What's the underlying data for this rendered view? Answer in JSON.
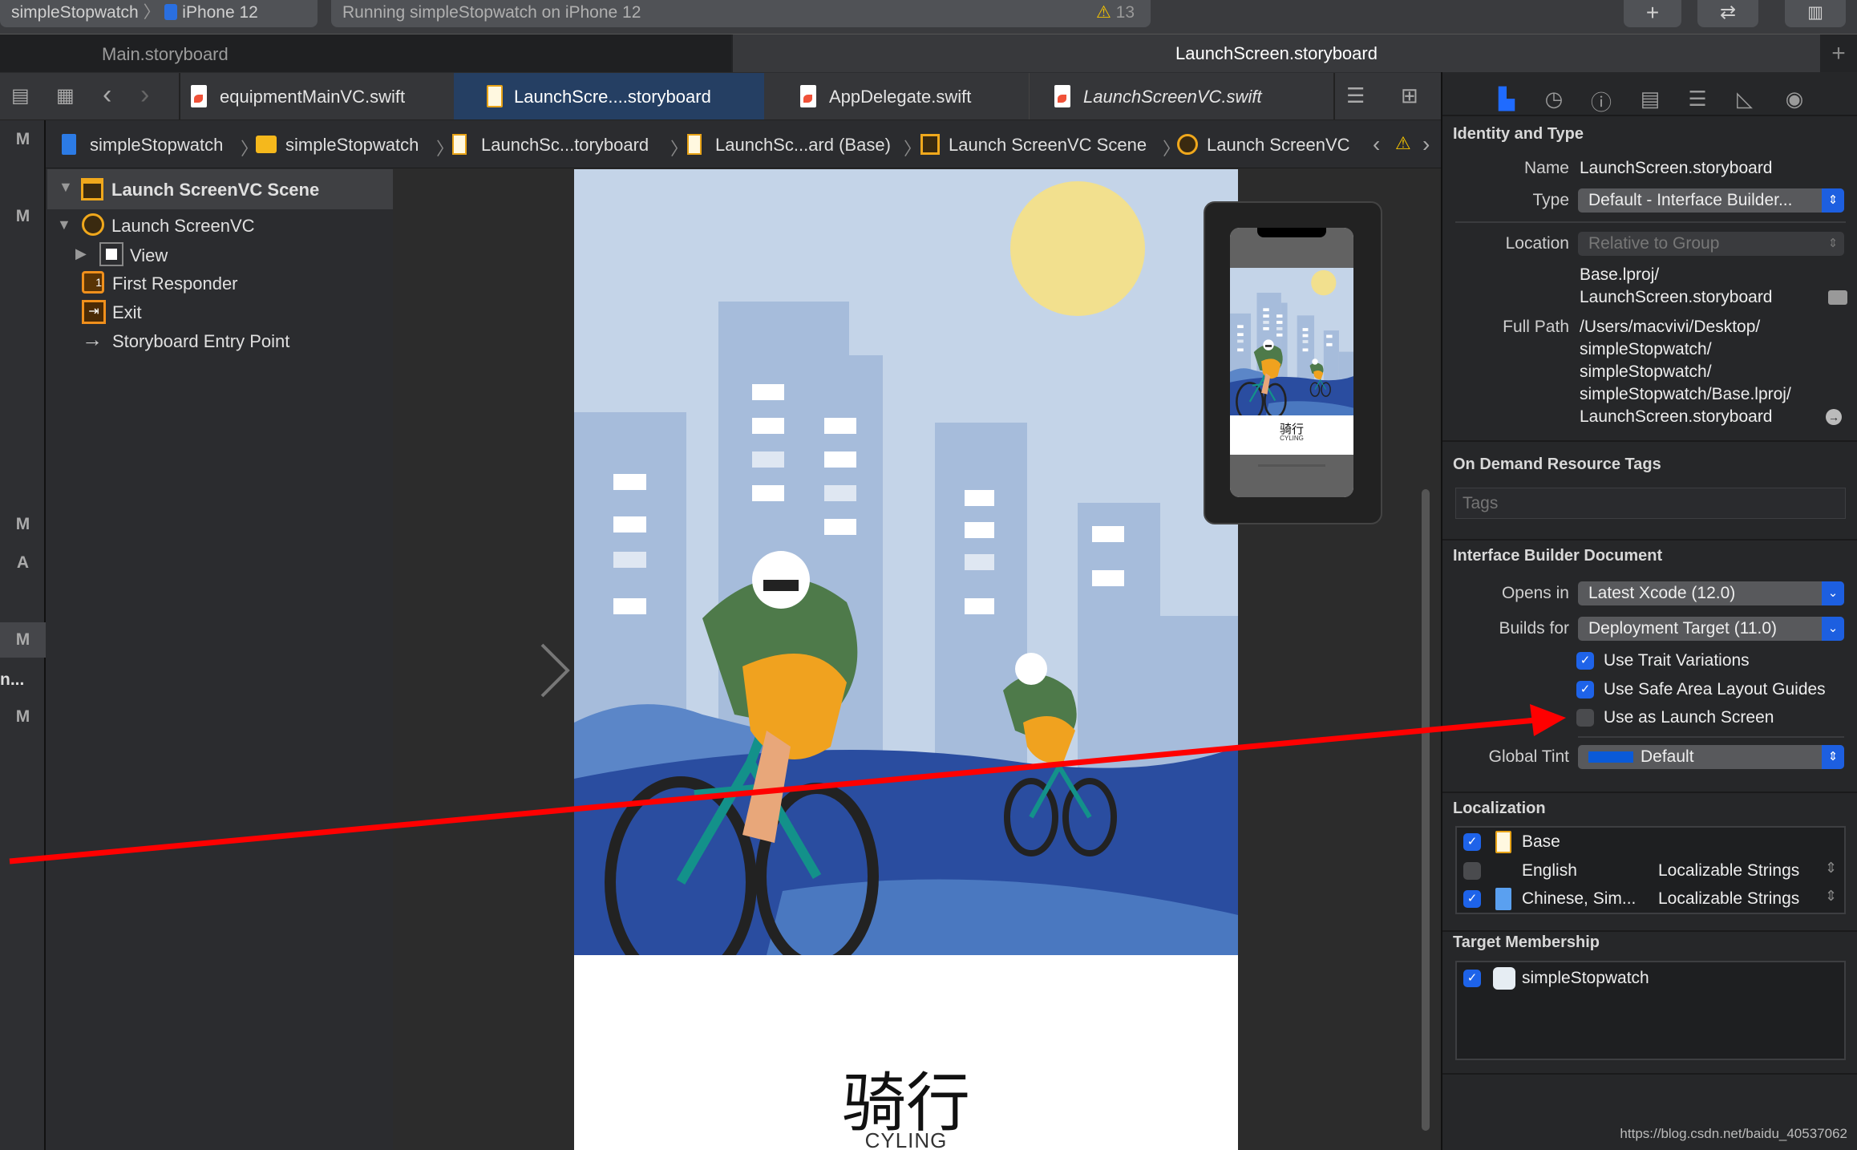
{
  "toolbar": {
    "scheme": "simpleStopwatch",
    "device": "iPhone 12",
    "status": "Running simpleStopwatch on iPhone 12",
    "warning_count": "13"
  },
  "window_tabs": [
    {
      "label": "Main.storyboard",
      "active": false
    },
    {
      "label": "LaunchScreen.storyboard",
      "active": true
    }
  ],
  "editor_tabs": [
    {
      "label": "equipmentMainVC.swift",
      "type": "swift",
      "active": false
    },
    {
      "label": "LaunchScre....storyboard",
      "type": "storyboard",
      "active": true
    },
    {
      "label": "AppDelegate.swift",
      "type": "swift",
      "active": false
    },
    {
      "label": "LaunchScreenVC.swift",
      "type": "swift",
      "active": false
    }
  ],
  "breadcrumb": [
    "simpleStopwatch",
    "simpleStopwatch",
    "LaunchSc...toryboard",
    "LaunchSc...ard (Base)",
    "Launch ScreenVC Scene",
    "Launch ScreenVC"
  ],
  "left_strip": [
    "M",
    "M",
    "M",
    "A",
    "M",
    "n...",
    "M"
  ],
  "outline": {
    "scene": "Launch ScreenVC Scene",
    "items": [
      {
        "label": "Launch ScreenVC"
      },
      {
        "label": "View"
      },
      {
        "label": "First Responder"
      },
      {
        "label": "Exit"
      },
      {
        "label": "Storyboard Entry Point"
      }
    ]
  },
  "scene": {
    "title": "骑行",
    "subtitle": "CYLING",
    "colors": {
      "sky": "#c4d4e8",
      "sun": "#f2e08e",
      "buildings": "#a6bcdb",
      "water": "#2a4da0",
      "jersey": "#4e7a4a",
      "shorts": "#f0a21f",
      "bike": "#13918a"
    }
  },
  "preview": {
    "title": "骑行",
    "subtitle": "CYLING"
  },
  "inspector": {
    "tabs": [
      "file-icon",
      "history-icon",
      "help-icon",
      "identity-icon",
      "attributes-icon",
      "size-icon",
      "connections-icon"
    ],
    "identity": {
      "heading": "Identity and Type",
      "name_label": "Name",
      "name": "LaunchScreen.storyboard",
      "type_label": "Type",
      "type": "Default - Interface Builder...",
      "location_label": "Location",
      "location": "Relative to Group",
      "relative_path": [
        "Base.lproj/",
        "LaunchScreen.storyboard"
      ],
      "full_path_label": "Full Path",
      "full_path": [
        "/Users/macvivi/Desktop/",
        "simpleStopwatch/",
        "simpleStopwatch/",
        "simpleStopwatch/Base.lproj/",
        "LaunchScreen.storyboard"
      ]
    },
    "tags": {
      "heading": "On Demand Resource Tags",
      "placeholder": "Tags"
    },
    "ibdoc": {
      "heading": "Interface Builder Document",
      "opens_label": "Opens in",
      "opens": "Latest Xcode (12.0)",
      "builds_label": "Builds for",
      "builds": "Deployment Target (11.0)",
      "checks": [
        {
          "label": "Use Trait Variations",
          "checked": true
        },
        {
          "label": "Use Safe Area Layout Guides",
          "checked": true
        },
        {
          "label": "Use as Launch Screen",
          "checked": false
        }
      ],
      "tint_label": "Global Tint",
      "tint": "Default",
      "tint_color": "#0a5ad8"
    },
    "localization": {
      "heading": "Localization",
      "rows": [
        {
          "lang": "Base",
          "checked": true,
          "mode": ""
        },
        {
          "lang": "English",
          "checked": false,
          "mode": "Localizable Strings"
        },
        {
          "lang": "Chinese, Sim...",
          "checked": true,
          "mode": "Localizable Strings"
        }
      ]
    },
    "membership": {
      "heading": "Target Membership",
      "targets": [
        {
          "name": "simpleStopwatch",
          "checked": true
        }
      ]
    }
  },
  "watermark": "https://blog.csdn.net/baidu_40537062",
  "annotation_color": "#ff0000"
}
